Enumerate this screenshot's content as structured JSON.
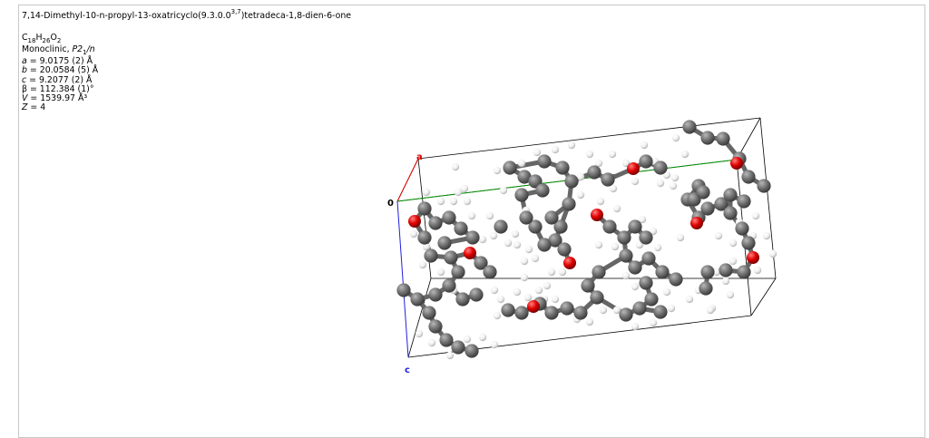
{
  "title": {
    "prefix": "7,14-Dimethyl-10-n-propyl-13-oxatricyclo(9.3.0.0",
    "superscript": "3,7",
    "suffix": ")tetradeca-1,8-dien-6-one"
  },
  "crystal": {
    "formula_parts": [
      "C",
      "18",
      "H",
      "26",
      "O",
      "2"
    ],
    "system_label": "Monoclinic, ",
    "space_group": "P2",
    "space_group_sub": "1",
    "space_group_suffix": "/n",
    "a": {
      "symbol": "a",
      "text": " = 9.0175 (2) Å"
    },
    "b": {
      "symbol": "b",
      "text": " = 20.0584 (5) Å"
    },
    "c": {
      "symbol": "c",
      "text": " = 9.2077 (2) Å"
    },
    "beta": {
      "symbol": "β",
      "text": " = 112.384 (1)°"
    },
    "V": {
      "symbol": "V",
      "text": " = 1539.97 Å³"
    },
    "Z": {
      "symbol": "Z",
      "text": " = 4"
    }
  },
  "viewer": {
    "axis_labels": {
      "a": "a",
      "origin": "0",
      "c": "c"
    },
    "colors": {
      "carbon": "#6b6b6b",
      "oxygen": "#e00000",
      "hydrogen": "#f4f4f4",
      "axis_a": "#e00000",
      "axis_b": "#009000",
      "axis_c": "#2020e0",
      "cell": "#000000"
    }
  }
}
